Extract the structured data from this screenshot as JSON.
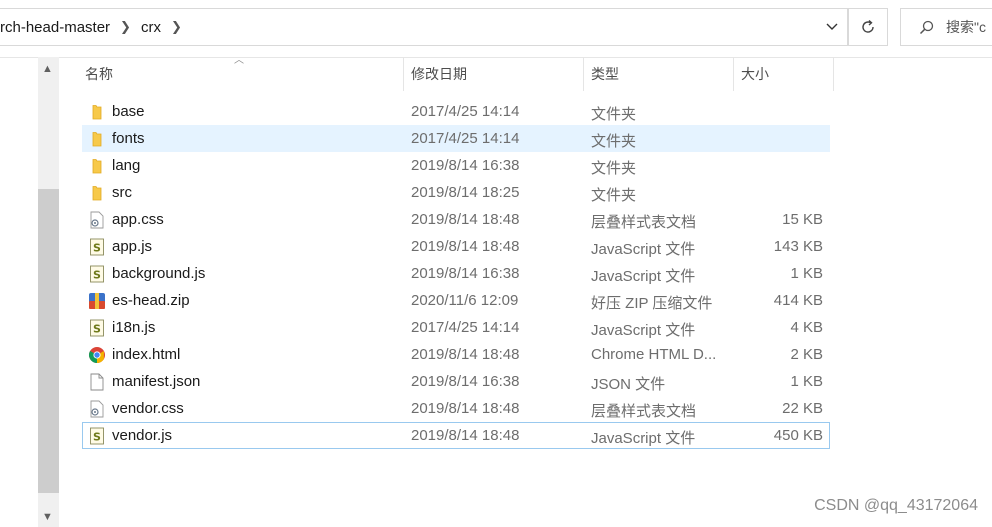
{
  "address_bar": {
    "breadcrumbs": [
      "rch-head-master",
      "crx"
    ],
    "search_placeholder": "搜索\"c"
  },
  "columns": {
    "name": "名称",
    "date": "修改日期",
    "type": "类型",
    "size": "大小"
  },
  "files": [
    {
      "name": "base",
      "date": "2017/4/25 14:14",
      "type": "文件夹",
      "size": "",
      "icon": "folder-icon"
    },
    {
      "name": "fonts",
      "date": "2017/4/25 14:14",
      "type": "文件夹",
      "size": "",
      "icon": "folder-icon"
    },
    {
      "name": "lang",
      "date": "2019/8/14 16:38",
      "type": "文件夹",
      "size": "",
      "icon": "folder-icon"
    },
    {
      "name": "src",
      "date": "2019/8/14 18:25",
      "type": "文件夹",
      "size": "",
      "icon": "folder-icon"
    },
    {
      "name": "app.css",
      "date": "2019/8/14 18:48",
      "type": "层叠样式表文档",
      "size": "15 KB",
      "icon": "css-file-icon"
    },
    {
      "name": "app.js",
      "date": "2019/8/14 18:48",
      "type": "JavaScript 文件",
      "size": "143 KB",
      "icon": "js-file-icon"
    },
    {
      "name": "background.js",
      "date": "2019/8/14 16:38",
      "type": "JavaScript 文件",
      "size": "1 KB",
      "icon": "js-file-icon"
    },
    {
      "name": "es-head.zip",
      "date": "2020/11/6 12:09",
      "type": "好压 ZIP 压缩文件",
      "size": "414 KB",
      "icon": "zip-file-icon"
    },
    {
      "name": "i18n.js",
      "date": "2017/4/25 14:14",
      "type": "JavaScript 文件",
      "size": "4 KB",
      "icon": "js-file-icon"
    },
    {
      "name": "index.html",
      "date": "2019/8/14 18:48",
      "type": "Chrome HTML D...",
      "size": "2 KB",
      "icon": "chrome-icon"
    },
    {
      "name": "manifest.json",
      "date": "2019/8/14 16:38",
      "type": "JSON 文件",
      "size": "1 KB",
      "icon": "blank-file-icon"
    },
    {
      "name": "vendor.css",
      "date": "2019/8/14 18:48",
      "type": "层叠样式表文档",
      "size": "22 KB",
      "icon": "css-file-icon"
    },
    {
      "name": "vendor.js",
      "date": "2019/8/14 18:48",
      "type": "JavaScript 文件",
      "size": "450 KB",
      "icon": "js-file-icon"
    }
  ],
  "watermark": "CSDN @qq_43172064"
}
